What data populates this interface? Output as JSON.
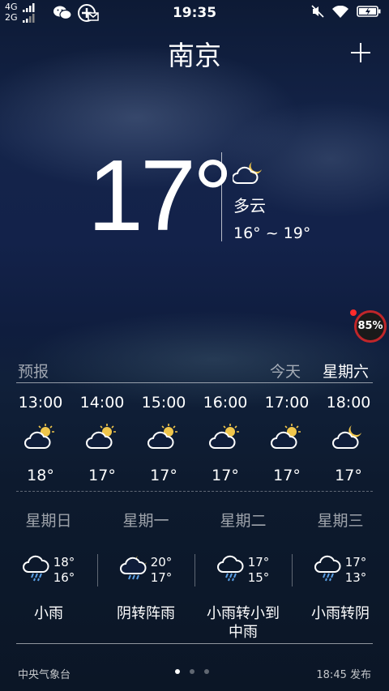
{
  "status_bar": {
    "network_top": "4G",
    "network_bottom": "2G",
    "time": "19:35"
  },
  "header": {
    "city": "南京",
    "add_label": "+"
  },
  "current": {
    "temperature": "17°",
    "condition": "多云",
    "range": "16° ~ 19°",
    "icon": "partly-cloudy-night-icon"
  },
  "badge": {
    "value": "85%",
    "color": "#c0262a"
  },
  "forecast": {
    "title": "预报",
    "today_label": "今天",
    "weekday_label": "星期六",
    "hourly": [
      {
        "time": "13:00",
        "temp": "18°",
        "icon": "partly-cloudy-sun-icon"
      },
      {
        "time": "14:00",
        "temp": "17°",
        "icon": "partly-cloudy-sun-icon"
      },
      {
        "time": "15:00",
        "temp": "17°",
        "icon": "partly-cloudy-sun-icon"
      },
      {
        "time": "16:00",
        "temp": "17°",
        "icon": "partly-cloudy-sun-icon"
      },
      {
        "time": "17:00",
        "temp": "17°",
        "icon": "partly-cloudy-sun-icon"
      },
      {
        "time": "18:00",
        "temp": "17°",
        "icon": "partly-cloudy-moon-icon"
      }
    ],
    "daily": [
      {
        "day": "星期日",
        "high": "18°",
        "low": "16°",
        "desc": "小雨",
        "icon": "rain-icon"
      },
      {
        "day": "星期一",
        "high": "20°",
        "low": "17°",
        "desc": "阴转阵雨",
        "icon": "rain-moon-icon"
      },
      {
        "day": "星期二",
        "high": "17°",
        "low": "15°",
        "desc": "小雨转小到中雨",
        "icon": "rain-icon"
      },
      {
        "day": "星期三",
        "high": "17°",
        "low": "13°",
        "desc": "小雨转阴",
        "icon": "rain-icon"
      }
    ]
  },
  "footer": {
    "source": "中央气象台",
    "published": "18:45 发布",
    "page_count": 3,
    "active_page": 1
  }
}
